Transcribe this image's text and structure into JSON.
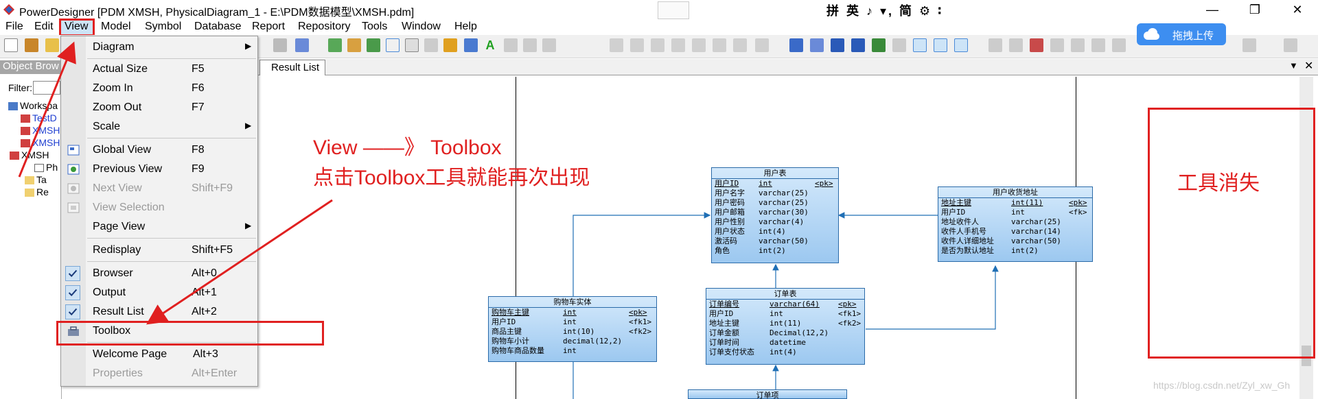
{
  "window": {
    "title": "PowerDesigner [PDM XMSH, PhysicalDiagram_1 - E:\\PDM数据模型\\XMSH.pdm]",
    "ime": "拼 英 ♪ ▾, 简 ⚙ ∶",
    "minimize": "—",
    "maximize": "❐",
    "close": "✕"
  },
  "menubar": [
    "File",
    "Edit",
    "View",
    "Model",
    "Symbol",
    "Database",
    "Report",
    "Repository",
    "Tools",
    "Window",
    "Help"
  ],
  "upload": {
    "label": "拖拽上传"
  },
  "object_browser": {
    "title": "Object Brow",
    "filter_label": "Filter:",
    "tree": [
      "Workspa",
      "TestD",
      "XMSH",
      "XMSH",
      "XMSH",
      "Ph",
      "Ta",
      "Re"
    ]
  },
  "tab": {
    "label": "Result List"
  },
  "view_menu": {
    "items": [
      {
        "label": "Diagram",
        "shortcut": "",
        "submenu": true
      },
      {
        "label": "Actual Size",
        "shortcut": "F5"
      },
      {
        "label": "Zoom In",
        "shortcut": "F6"
      },
      {
        "label": "Zoom Out",
        "shortcut": "F7"
      },
      {
        "label": "Scale",
        "shortcut": "",
        "submenu": true
      },
      {
        "label": "Global View",
        "shortcut": "F8"
      },
      {
        "label": "Previous View",
        "shortcut": "F9"
      },
      {
        "label": "Next View",
        "shortcut": "Shift+F9",
        "disabled": true
      },
      {
        "label": "View Selection",
        "shortcut": "",
        "disabled": true
      },
      {
        "label": "Page View",
        "shortcut": "",
        "submenu": true
      },
      {
        "label": "Redisplay",
        "shortcut": "Shift+F5"
      },
      {
        "label": "Browser",
        "shortcut": "Alt+0",
        "checked": true
      },
      {
        "label": "Output",
        "shortcut": "Alt+1",
        "checked": true
      },
      {
        "label": "Result List",
        "shortcut": "Alt+2",
        "checked": true
      },
      {
        "label": "Toolbox",
        "shortcut": ""
      },
      {
        "label": "Welcome Page",
        "shortcut": "Alt+3"
      },
      {
        "label": "Properties",
        "shortcut": "Alt+Enter",
        "disabled": true
      }
    ]
  },
  "annotations": {
    "line1": "View ——》 Toolbox",
    "line2": "点击Toolbox工具就能再次出现",
    "tool_missing": "工具消失"
  },
  "entities": {
    "user": {
      "title": "用户表",
      "rows": [
        [
          "用户ID",
          "int",
          "<pk>"
        ],
        [
          "用户名字",
          "varchar(25)",
          ""
        ],
        [
          "用户密码",
          "varchar(25)",
          ""
        ],
        [
          "用户邮箱",
          "varchar(30)",
          ""
        ],
        [
          "用户性别",
          "varchar(4)",
          ""
        ],
        [
          "用户状态",
          "int(4)",
          ""
        ],
        [
          "激活码",
          "varchar(50)",
          ""
        ],
        [
          "角色",
          "int(2)",
          ""
        ]
      ]
    },
    "address": {
      "title": "用户收货地址",
      "rows": [
        [
          "地址主键",
          "int(11)",
          "<pk>"
        ],
        [
          "用户ID",
          "int",
          "<fk>"
        ],
        [
          "地址收件人",
          "varchar(25)",
          ""
        ],
        [
          "收件人手机号",
          "varchar(14)",
          ""
        ],
        [
          "收件人详细地址",
          "varchar(50)",
          ""
        ],
        [
          "是否为默认地址",
          "int(2)",
          ""
        ]
      ]
    },
    "cart": {
      "title": "购物车实体",
      "rows": [
        [
          "购物车主键",
          "int",
          "<pk>"
        ],
        [
          "用户ID",
          "int",
          "<fk1>"
        ],
        [
          "商品主键",
          "int(10)",
          "<fk2>"
        ],
        [
          "购物车小计",
          "decimal(12,2)",
          ""
        ],
        [
          "购物车商品数量",
          "int",
          ""
        ]
      ]
    },
    "order": {
      "title": "订单表",
      "rows": [
        [
          "订单编号",
          "varchar(64)",
          "<pk>"
        ],
        [
          "用户ID",
          "int",
          "<fk1>"
        ],
        [
          "地址主键",
          "int(11)",
          "<fk2>"
        ],
        [
          "订单金额",
          "Decimal(12,2)",
          ""
        ],
        [
          "订单时间",
          "datetime",
          ""
        ],
        [
          "订单支付状态",
          "int(4)",
          ""
        ]
      ]
    },
    "order_item": {
      "title": "订单项"
    }
  },
  "watermark": "https://blog.csdn.net/Zyl_xw_Gh"
}
